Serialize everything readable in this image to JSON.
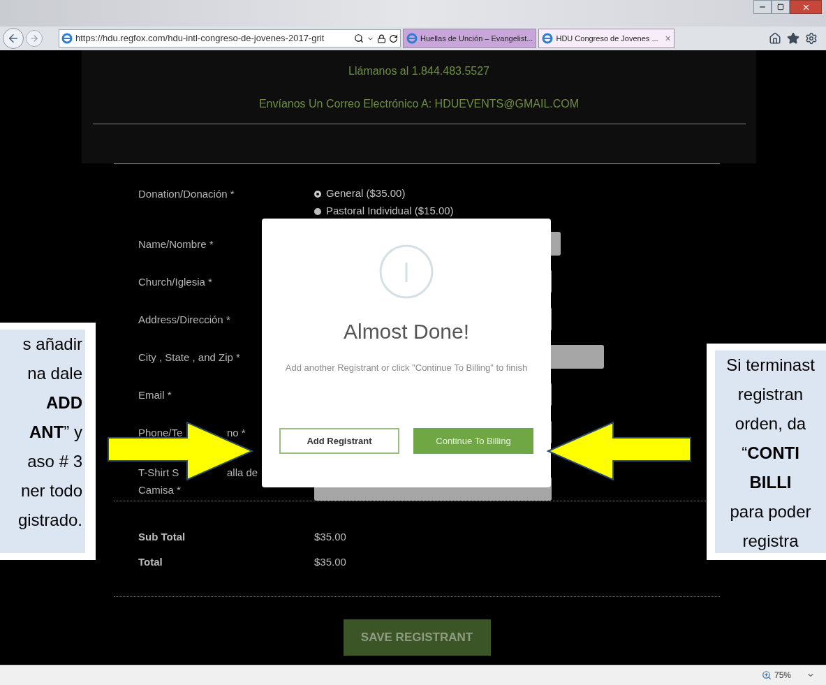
{
  "browser": {
    "url": "https://hdu.regfox.com/hdu-intl-congreso-de-jovenes-2017-grit",
    "tabs": [
      {
        "title": "Huellas de Unción – Evangelist...",
        "selected": false
      },
      {
        "title": "HDU Congreso de Jovenes ...",
        "selected": true,
        "close": "×"
      }
    ]
  },
  "header": {
    "phone": "Llámanos al 1.844.483.5527",
    "email": "Envíanos Un Correo Electrónico A: HDUEVENTS@GMAIL.COM"
  },
  "form": {
    "donation": {
      "label": "Donation/Donación *",
      "options": [
        {
          "label": "General ($35.00)",
          "selected": true
        },
        {
          "label": "Pastoral Individual ($15.00)",
          "selected": false
        }
      ]
    },
    "fields": [
      {
        "lines": [
          [
            "Name/Nombre *"
          ]
        ]
      },
      {
        "lines": [
          [
            "Church/Iglesia *"
          ]
        ]
      },
      {
        "lines": [
          [
            "Address/Dirección *"
          ]
        ]
      },
      {
        "lines": [
          [
            "City , State , and Zip  *"
          ]
        ]
      },
      {
        "lines": [
          [
            "Email *"
          ]
        ]
      },
      {
        "lines": [
          [
            "Phone/Te",
            "no *"
          ]
        ]
      },
      {
        "lines": [
          [
            "T-Shirt S",
            "alla de"
          ],
          [
            "Camisa *"
          ]
        ]
      }
    ],
    "totals": [
      {
        "label": "Sub Total",
        "value": "$35.00"
      },
      {
        "label": "Total",
        "value": "$35.00"
      }
    ],
    "save_button": "SAVE REGISTRANT"
  },
  "dialog": {
    "title": "Almost Done!",
    "message": "Add another Registrant or click \"Continue To Billing\" to finish",
    "buttons": [
      {
        "label": "Add Registrant",
        "kind": "secondary"
      },
      {
        "label": "Continue To Billing",
        "kind": "primary"
      }
    ]
  },
  "annotations": [
    {
      "text": "s añadir\nna dale\n**ADD**\n**ANT**” y\naso # 3\nner todo\ngistrado."
    },
    {
      "text": "Si terminast\nregistran\norden, da\n“**CONTI**\n**BILLI**\npara poder\nregistra"
    }
  ],
  "status_bar": {
    "zoom": "75%"
  }
}
